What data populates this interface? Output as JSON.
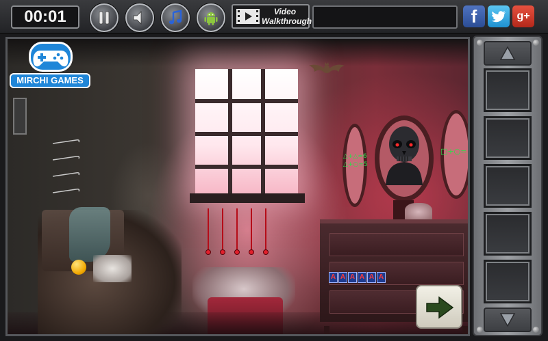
{
  "hud": {
    "timer": "00:01",
    "video_line1": "Video",
    "video_line2": "Walkthrough",
    "facebook_glyph": "f",
    "googleplus_glyph": "g+"
  },
  "icons": {
    "pause": "pause-icon",
    "sound": "speaker-icon",
    "music": "music-note-icon",
    "android": "android-icon",
    "video": "film-play-icon",
    "twitter": "bird-icon",
    "next": "arrow-right-icon"
  },
  "logo": {
    "name": "MIRCHI GAMES"
  },
  "scene": {
    "clue_left_line1": "△+△=6",
    "clue_left_line2": "△+○=5",
    "clue_right": "□+○=",
    "code_tiles": [
      "A",
      "A",
      "A",
      "A",
      "A",
      "A"
    ],
    "slider_count": 5,
    "hook_count": 4
  },
  "inventory": {
    "slot_count": 5
  },
  "colors": {
    "accent_blue": "#1f86d8",
    "clue_green": "#2ce04a",
    "slider_red": "#b50c18",
    "facebook": "#3b5998",
    "twitter": "#1da1f2",
    "googleplus": "#dd4b39"
  }
}
